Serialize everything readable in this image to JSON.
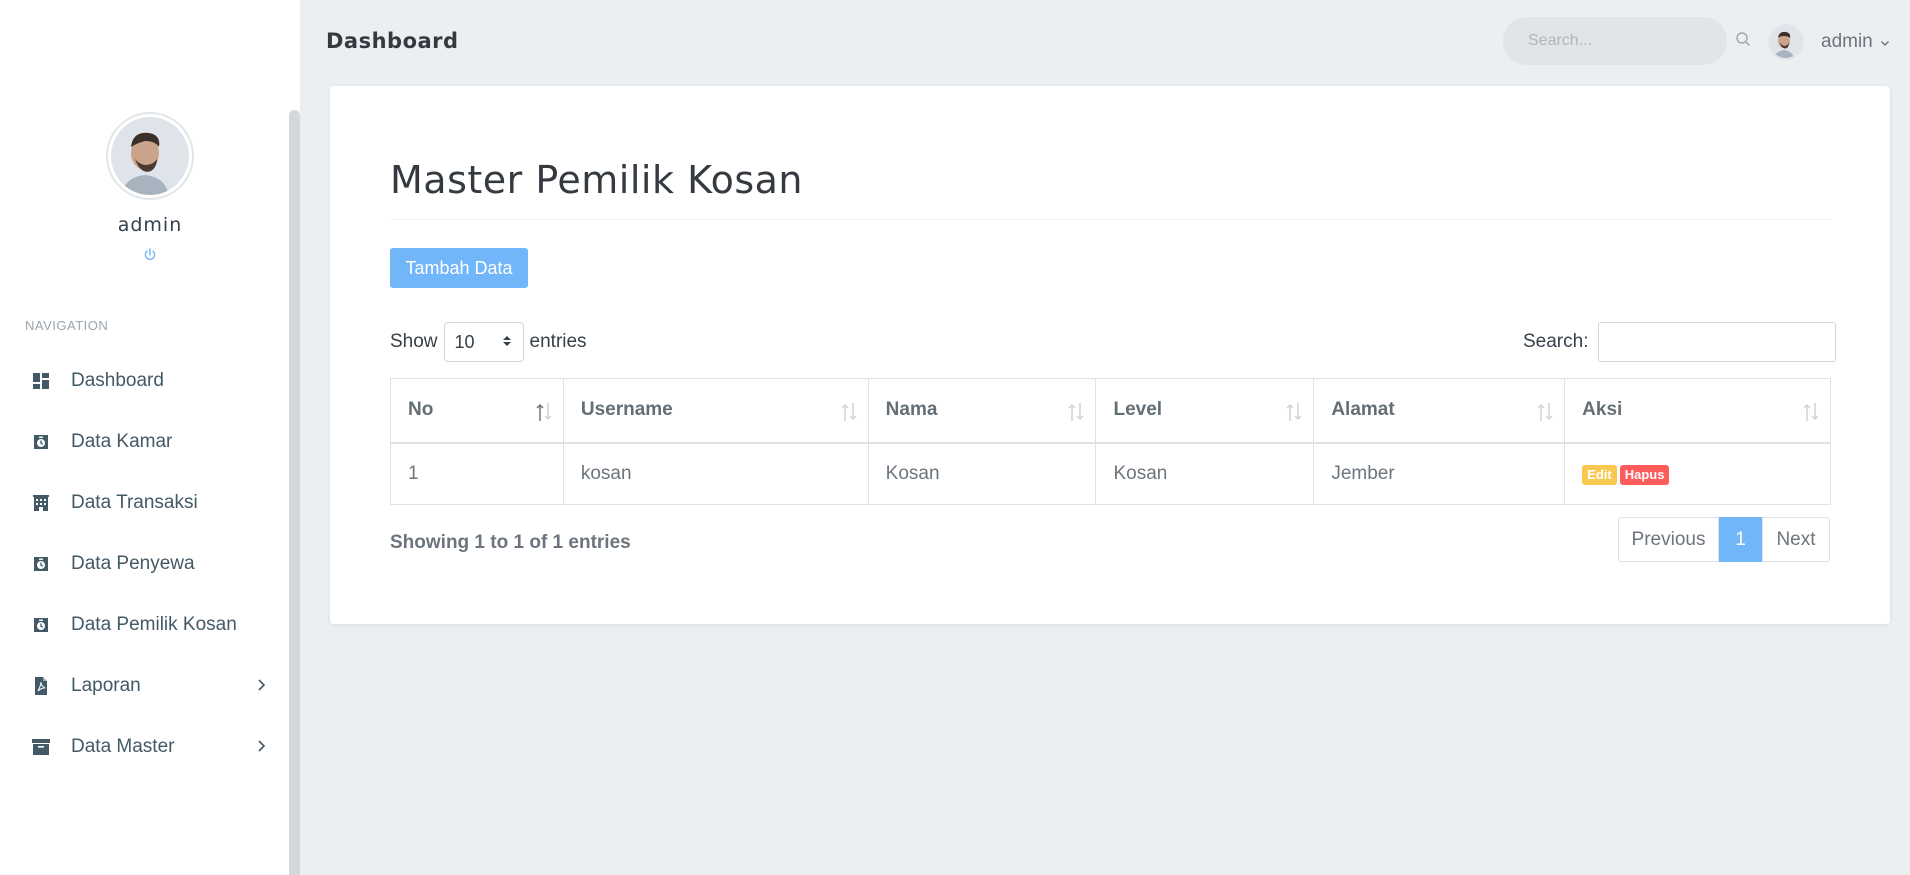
{
  "header": {
    "page_title": "Dashboard",
    "search_placeholder": "Search...",
    "user_name": "admin"
  },
  "sidebar": {
    "profile_name": "admin",
    "nav_title": "Navigation",
    "items": [
      {
        "label": "Dashboard",
        "icon": "dashboard-icon"
      },
      {
        "label": "Data Kamar",
        "icon": "stopwatch-icon"
      },
      {
        "label": "Data Transaksi",
        "icon": "building-icon"
      },
      {
        "label": "Data Penyewa",
        "icon": "stopwatch-icon"
      },
      {
        "label": "Data Pemilik Kosan",
        "icon": "stopwatch-icon"
      },
      {
        "label": "Laporan",
        "icon": "pdf-file-icon",
        "has_children": true
      },
      {
        "label": "Data Master",
        "icon": "archive-icon",
        "has_children": true
      }
    ]
  },
  "main": {
    "title": "Master Pemilik Kosan",
    "add_button": "Tambah Data",
    "length": {
      "show": "Show",
      "value": "10",
      "entries": "entries"
    },
    "filter": {
      "label": "Search:",
      "value": ""
    },
    "table": {
      "columns": [
        "No",
        "Username",
        "Nama",
        "Level",
        "Alamat",
        "Aksi"
      ],
      "rows": [
        {
          "no": "1",
          "username": "kosan",
          "nama": "Kosan",
          "level": "Kosan",
          "alamat": "Jember",
          "actions": [
            "Edit",
            "Hapus"
          ]
        }
      ]
    },
    "info": "Showing 1 to 1 of 1 entries",
    "pagination": {
      "previous": "Previous",
      "current": "1",
      "next": "Next"
    }
  },
  "colors": {
    "primary": "#71b6f9",
    "warning": "#f9c851",
    "danger": "#ff5b5b",
    "background": "#ebeff2"
  }
}
